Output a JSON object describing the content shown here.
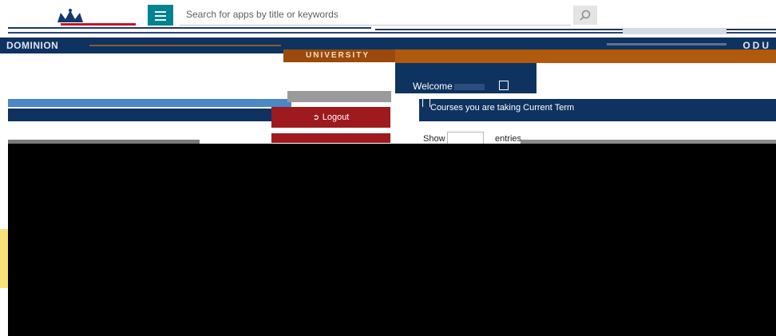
{
  "topbar": {
    "search_placeholder": "Search for apps by title or keywords",
    "colors": {
      "menu_button": "#00838f",
      "logo_underline": "#c0182b"
    }
  },
  "navband": {
    "brand_name": "DOMINION",
    "brand_right": "ODU",
    "colors": {
      "background": "#0e3360"
    }
  },
  "banner": {
    "word": "UNIVERSITY",
    "colors": {
      "background": "#9a4a0c",
      "strip": "#b05a0e"
    }
  },
  "welcome": {
    "greeting": "Welcome"
  },
  "courses": {
    "heading": "Courses you are taking Current Term"
  },
  "actions": {
    "logout_label": "Logout",
    "logout_icon": "sign-out-icon",
    "logout_color": "#9e1a1e"
  },
  "table_controls": {
    "show_label": "Show",
    "entries_label": "entries"
  },
  "icons": {
    "search": "search-icon",
    "menu": "menu-icon",
    "crown": "crown-logo"
  }
}
